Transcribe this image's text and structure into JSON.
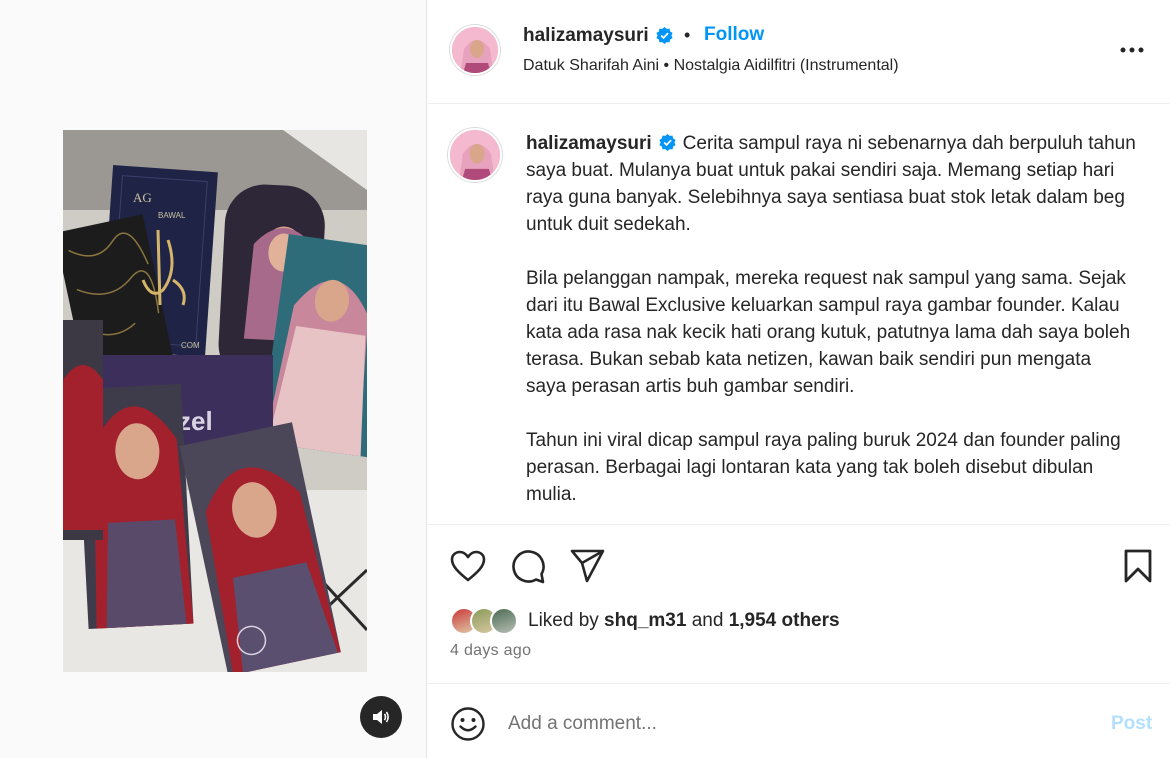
{
  "header": {
    "username": "halizamaysuri",
    "separator": "•",
    "follow_label": "Follow",
    "audio": "Datuk Sharifah Aini • Nostalgia Aidilfitri (Instrumental)",
    "more_icon": "more-horizontal-icon"
  },
  "caption": {
    "username": "halizamaysuri",
    "paragraphs": [
      "Cerita sampul raya ni sebenarnya dah berpuluh tahun saya buat. Mulanya buat untuk pakai sendiri saja. Memang setiap hari raya guna banyak. Selebihnya saya sentiasa buat stok letak dalam beg untuk duit sedekah.",
      "Bila pelanggan nampak, mereka request nak sampul yang sama. Sejak dari itu Bawal Exclusive keluarkan sampul raya gambar founder. Kalau kata ada rasa nak kecik hati orang kutuk, patutnya lama dah saya boleh terasa. Bukan sebab kata netizen, kawan baik sendiri pun mengata saya perasan artis buh gambar sendiri.",
      "Tahun ini viral dicap sampul raya paling buruk 2024 dan founder paling perasan. Berbagai lagi lontaran kata yang tak boleh disebut dibulan mulia."
    ]
  },
  "actions": {
    "like_icon": "heart-icon",
    "comment_icon": "comment-icon",
    "share_icon": "send-icon",
    "save_icon": "bookmark-icon"
  },
  "likes": {
    "prefix": "Liked by ",
    "user": "shq_m31",
    "middle": " and ",
    "others": "1,954 others"
  },
  "timestamp": "4 days ago",
  "comment": {
    "placeholder": "Add a comment...",
    "post_label": "Post",
    "emoji_icon": "emoji-smile-icon"
  },
  "media": {
    "mute_icon": "speaker-icon",
    "envelope_text_1": "AG",
    "envelope_text_2": "BAWAL",
    "envelope_text_3": "COM",
    "envelope_text_4": "zel"
  },
  "colors": {
    "accent": "#0095f6",
    "post_disabled": "#b2dffc",
    "verified": "#0095f6",
    "hijab_red": "#a3202d",
    "hijab_pink": "#c9879c"
  }
}
